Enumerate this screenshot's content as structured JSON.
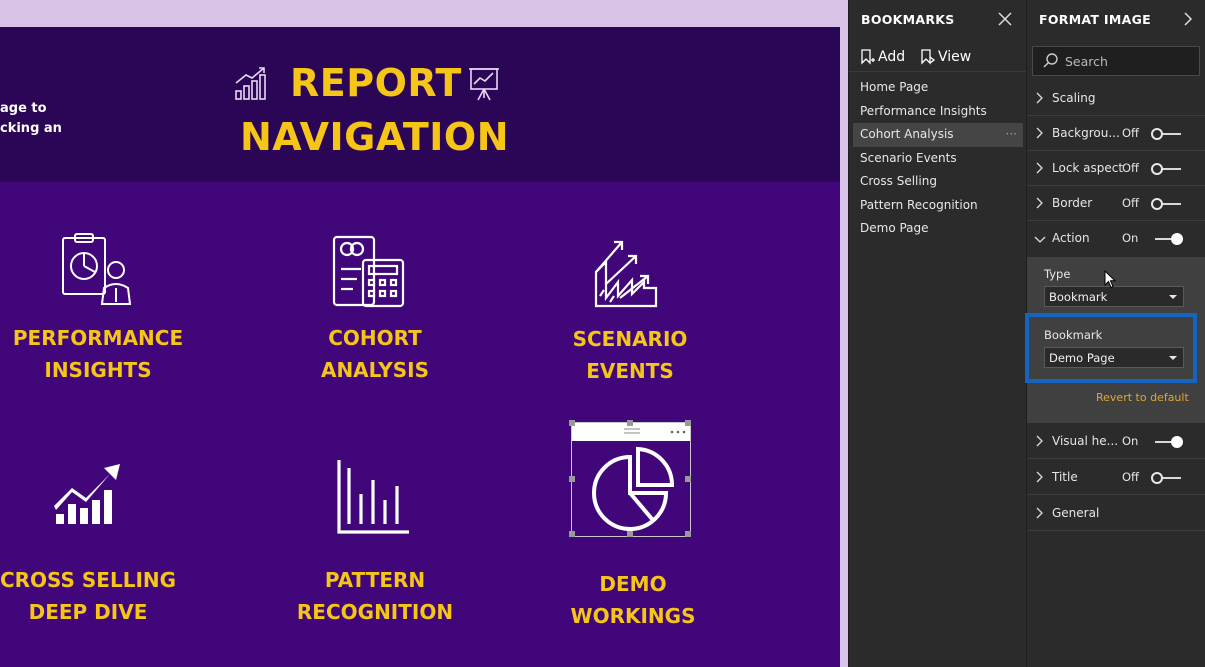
{
  "report": {
    "side_text_line1": "age to",
    "side_text_line2": "cking an",
    "title_line1": "REPORT",
    "title_line2": "NAVIGATION",
    "tiles": [
      {
        "line1": "PERFORMANCE",
        "line2": "INSIGHTS"
      },
      {
        "line1": "COHORT",
        "line2": "ANALYSIS"
      },
      {
        "line1": "SCENARIO",
        "line2": "EVENTS"
      },
      {
        "line1": "CROSS SELLING",
        "line2": "DEEP DIVE"
      },
      {
        "line1": "PATTERN",
        "line2": "RECOGNITION"
      },
      {
        "line1": "DEMO",
        "line2": "WORKINGS"
      }
    ]
  },
  "bookmarks": {
    "title": "BOOKMARKS",
    "add_label": "Add",
    "view_label": "View",
    "items": [
      {
        "label": "Home Page"
      },
      {
        "label": "Performance Insights"
      },
      {
        "label": "Cohort Analysis"
      },
      {
        "label": "Scenario Events"
      },
      {
        "label": "Cross Selling"
      },
      {
        "label": "Pattern Recognition"
      },
      {
        "label": "Demo Page"
      }
    ],
    "active_index": 2,
    "more_glyph": "···"
  },
  "format": {
    "title": "FORMAT IMAGE",
    "search_placeholder": "Search",
    "sections": {
      "scaling": {
        "label": "Scaling"
      },
      "background": {
        "label": "Backgrou...",
        "state": "Off"
      },
      "lock_aspect": {
        "label": "Lock aspect",
        "state": "Off"
      },
      "border": {
        "label": "Border",
        "state": "Off"
      },
      "action": {
        "label": "Action",
        "state": "On"
      },
      "visual_header": {
        "label": "Visual he...",
        "state": "On"
      },
      "title": {
        "label": "Title",
        "state": "Off"
      },
      "general": {
        "label": "General"
      }
    },
    "action": {
      "type_label": "Type",
      "type_value": "Bookmark",
      "bookmark_label": "Bookmark",
      "bookmark_value": "Demo Page",
      "revert_label": "Revert to default"
    }
  },
  "colors": {
    "report_bg": "#41077a",
    "header_bg": "#2c0656",
    "title_gold": "#f5c518",
    "pane_bg": "#2b2b2b",
    "highlight_blue": "#1565c0",
    "revert_orange": "#e0a92e"
  }
}
